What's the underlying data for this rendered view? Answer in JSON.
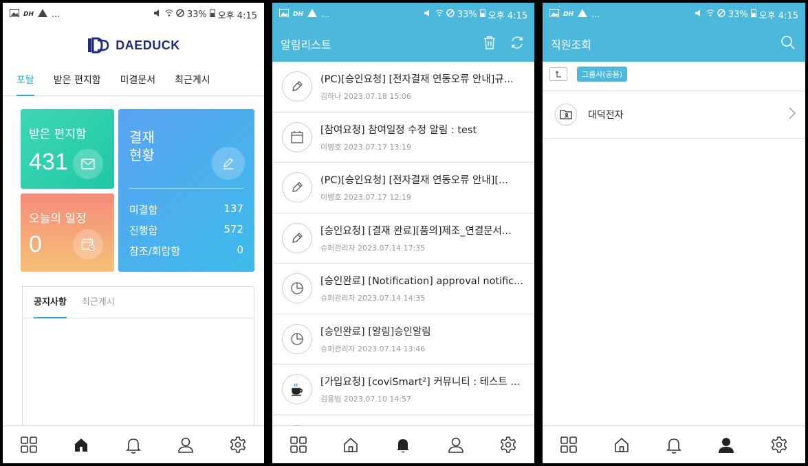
{
  "status_bar": {
    "battery": "33%",
    "time": "오후 4:15",
    "carrier": "DH"
  },
  "screen1": {
    "brand": "DAEDUCK",
    "tabs": [
      "포탈",
      "받은 편지함",
      "미결문서",
      "최근게시"
    ],
    "mail_tile": {
      "label": "받은 편지함",
      "count": "431"
    },
    "schedule_tile": {
      "label": "오늘의 일정",
      "count": "0"
    },
    "approval_tile": {
      "title_line1": "결재",
      "title_line2": "현황",
      "rows": [
        {
          "label": "미결함",
          "value": "137"
        },
        {
          "label": "진행함",
          "value": "572"
        },
        {
          "label": "참조/회람함",
          "value": "0"
        }
      ]
    },
    "notice_tabs": [
      "공지사항",
      "최근게시"
    ]
  },
  "screen2": {
    "title": "알림리스트",
    "items": [
      {
        "icon": "pen-icon",
        "title": "(PC)[승인요청] [전자결재 연동오류 안내]규...",
        "meta": "김하나 2023.07.18 15:06"
      },
      {
        "icon": "calendar-icon",
        "title": "[참여요청] 참여일정 수정 알림 : test",
        "meta": "이병호 2023.07.17 13:19"
      },
      {
        "icon": "pen-icon",
        "title": "(PC)[승인요청] [전자결재 연동오류 안내][...",
        "meta": "이병호 2023.07.17 12:19"
      },
      {
        "icon": "pen-icon",
        "title": "[승인요청] [결재 완료][품의]제조_연결문서...",
        "meta": "슈퍼관리자 2023.07.14 17:35"
      },
      {
        "icon": "pie-icon",
        "title": "[승인완료] [Notification] approval notific...",
        "meta": "슈퍼관리자 2023.07.14 14:35"
      },
      {
        "icon": "pie-icon",
        "title": "[승인완료] [알림]승인알림",
        "meta": "슈퍼관리자 2023.07.14 13:46"
      },
      {
        "icon": "cup-icon",
        "title": "[가입요청] [coviSmart²] 커뮤니티 : 테스트 ...",
        "meta": "김용범 2023.07.10 14:57"
      }
    ]
  },
  "screen3": {
    "title": "직원조회",
    "group_badge": "그룹사(공용)",
    "org_name": "대덕전자"
  }
}
